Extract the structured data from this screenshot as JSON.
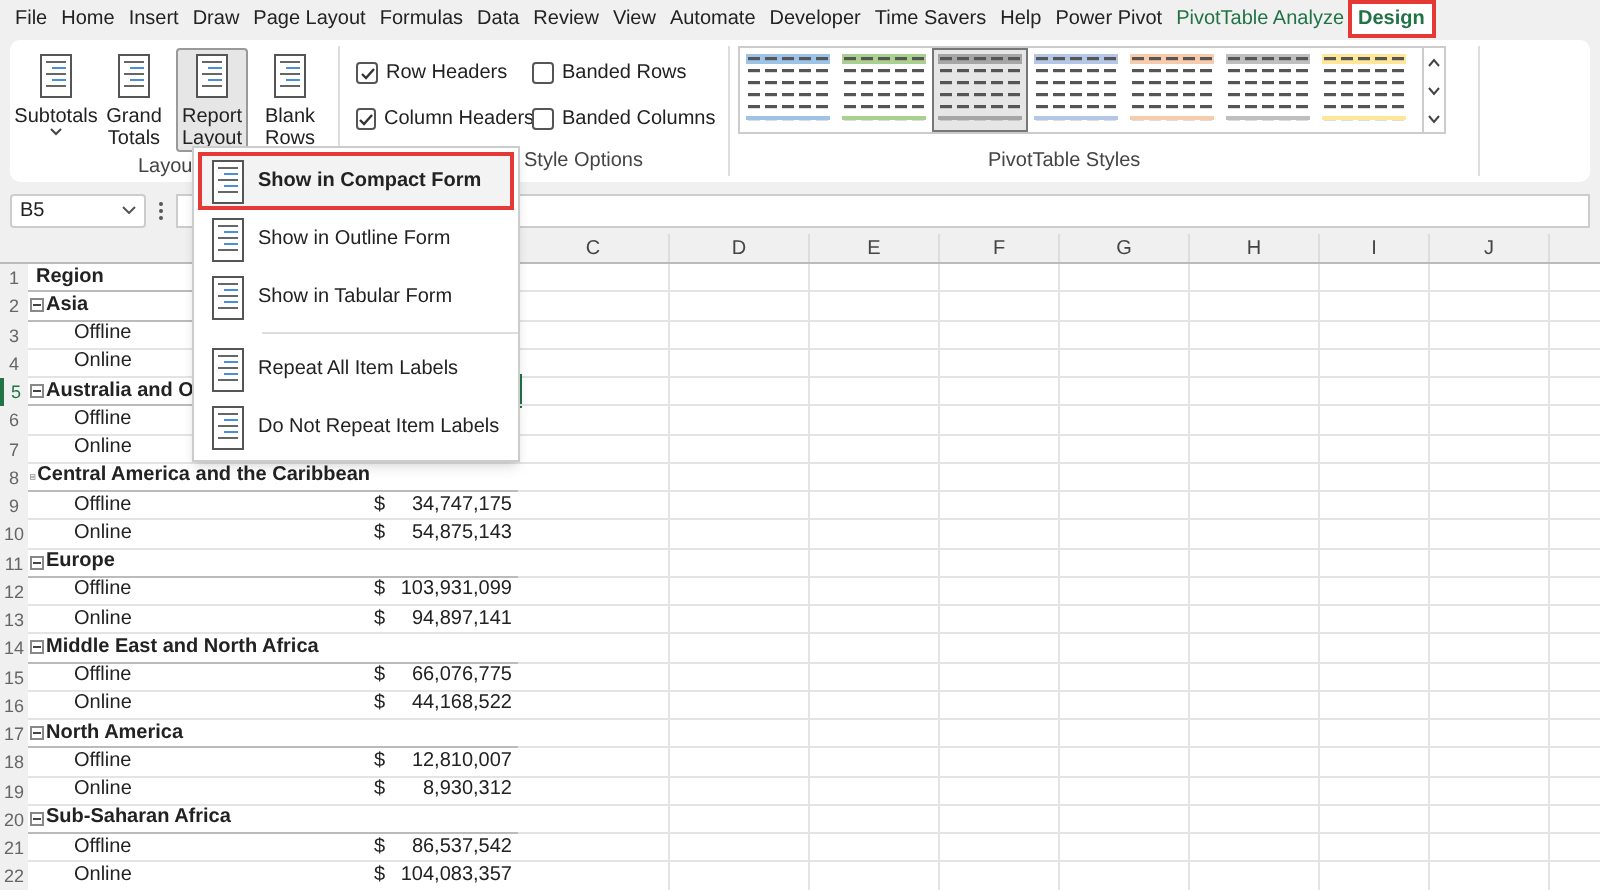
{
  "menu_tabs": [
    {
      "label": "File",
      "selected": false,
      "contextual": false,
      "annotated": false
    },
    {
      "label": "Home",
      "selected": false,
      "contextual": false,
      "annotated": false
    },
    {
      "label": "Insert",
      "selected": false,
      "contextual": false,
      "annotated": false
    },
    {
      "label": "Draw",
      "selected": false,
      "contextual": false,
      "annotated": false
    },
    {
      "label": "Page Layout",
      "selected": false,
      "contextual": false,
      "annotated": false
    },
    {
      "label": "Formulas",
      "selected": false,
      "contextual": false,
      "annotated": false
    },
    {
      "label": "Data",
      "selected": false,
      "contextual": false,
      "annotated": false
    },
    {
      "label": "Review",
      "selected": false,
      "contextual": false,
      "annotated": false
    },
    {
      "label": "View",
      "selected": false,
      "contextual": false,
      "annotated": false
    },
    {
      "label": "Automate",
      "selected": false,
      "contextual": false,
      "annotated": false
    },
    {
      "label": "Developer",
      "selected": false,
      "contextual": false,
      "annotated": false
    },
    {
      "label": "Time Savers",
      "selected": false,
      "contextual": false,
      "annotated": false
    },
    {
      "label": "Help",
      "selected": false,
      "contextual": false,
      "annotated": false
    },
    {
      "label": "Power Pivot",
      "selected": false,
      "contextual": false,
      "annotated": false
    },
    {
      "label": "PivotTable Analyze",
      "selected": false,
      "contextual": true,
      "annotated": false
    },
    {
      "label": "Design",
      "selected": true,
      "contextual": true,
      "annotated": true
    }
  ],
  "ribbon": {
    "layout_group": {
      "label": "Layou",
      "buttons": [
        {
          "lines": [
            "Subtotals"
          ],
          "selected": false
        },
        {
          "lines": [
            "Grand",
            "Totals"
          ],
          "selected": false
        },
        {
          "lines": [
            "Report",
            "Layout"
          ],
          "selected": true
        },
        {
          "lines": [
            "Blank",
            "Rows"
          ],
          "selected": false
        }
      ]
    },
    "style_options_group": {
      "label": "Style Options",
      "options": [
        {
          "label": "Row Headers",
          "checked": true
        },
        {
          "label": "Banded Rows",
          "checked": false
        },
        {
          "label": "Column Headers",
          "checked": true
        },
        {
          "label": "Banded Columns",
          "checked": false
        }
      ]
    },
    "styles_group": {
      "label": "PivotTable Styles",
      "styles": [
        {
          "color": "#9dc3e6",
          "selected": false
        },
        {
          "color": "#a9d08e",
          "selected": false
        },
        {
          "color": "#a6a6a6",
          "selected": true
        },
        {
          "color": "#b4c7e7",
          "selected": false
        },
        {
          "color": "#f8cbad",
          "selected": false
        },
        {
          "color": "#bfbfbf",
          "selected": false
        },
        {
          "color": "#ffe699",
          "selected": false
        }
      ]
    }
  },
  "name_box": {
    "value": "B5"
  },
  "columns": [
    "C",
    "D",
    "E",
    "F",
    "G",
    "H",
    "I",
    "J"
  ],
  "rows": [
    {
      "number": "1",
      "kind": "header",
      "label": "Region",
      "selected": false
    },
    {
      "number": "2",
      "kind": "region",
      "label": "Asia",
      "selected": false
    },
    {
      "number": "3",
      "kind": "item",
      "label": "Offline",
      "selected": false
    },
    {
      "number": "4",
      "kind": "item",
      "label": "Online",
      "selected": false
    },
    {
      "number": "5",
      "kind": "region",
      "label": "Australia and O",
      "selected": true
    },
    {
      "number": "6",
      "kind": "item",
      "label": "Offline",
      "selected": false
    },
    {
      "number": "7",
      "kind": "item",
      "label": "Online",
      "selected": false
    },
    {
      "number": "8",
      "kind": "region",
      "label": "Central America and the Caribbean",
      "selected": false
    },
    {
      "number": "9",
      "kind": "item",
      "label": "Offline",
      "currency": "$",
      "value": "34,747,175",
      "selected": false
    },
    {
      "number": "10",
      "kind": "item",
      "label": "Online",
      "currency": "$",
      "value": "54,875,143",
      "selected": false
    },
    {
      "number": "11",
      "kind": "region",
      "label": "Europe",
      "selected": false
    },
    {
      "number": "12",
      "kind": "item",
      "label": "Offline",
      "currency": "$",
      "value": "103,931,099",
      "selected": false
    },
    {
      "number": "13",
      "kind": "item",
      "label": "Online",
      "currency": "$",
      "value": "94,897,141",
      "selected": false
    },
    {
      "number": "14",
      "kind": "region",
      "label": "Middle East and North Africa",
      "selected": false
    },
    {
      "number": "15",
      "kind": "item",
      "label": "Offline",
      "currency": "$",
      "value": "66,076,775",
      "selected": false
    },
    {
      "number": "16",
      "kind": "item",
      "label": "Online",
      "currency": "$",
      "value": "44,168,522",
      "selected": false
    },
    {
      "number": "17",
      "kind": "region",
      "label": "North America",
      "selected": false
    },
    {
      "number": "18",
      "kind": "item",
      "label": "Offline",
      "currency": "$",
      "value": "12,810,007",
      "selected": false
    },
    {
      "number": "19",
      "kind": "item",
      "label": "Online",
      "currency": "$",
      "value": "8,930,312",
      "selected": false
    },
    {
      "number": "20",
      "kind": "region",
      "label": "Sub-Saharan Africa",
      "selected": false
    },
    {
      "number": "21",
      "kind": "item",
      "label": "Offline",
      "currency": "$",
      "value": "86,537,542",
      "selected": false
    },
    {
      "number": "22",
      "kind": "item",
      "label": "Online",
      "currency": "$",
      "value": "104,083,357",
      "selected": false
    }
  ],
  "dropdown_menu": {
    "items": [
      {
        "kind": "item",
        "label": "Show in Compact Form",
        "selected": true,
        "annotated": true
      },
      {
        "kind": "item",
        "label": "Show in Outline Form",
        "selected": false,
        "annotated": false
      },
      {
        "kind": "item",
        "label": "Show in Tabular Form",
        "selected": false,
        "annotated": false
      },
      {
        "kind": "separator"
      },
      {
        "kind": "item",
        "label": "Repeat All Item Labels",
        "selected": false,
        "annotated": false
      },
      {
        "kind": "item",
        "label": "Do Not Repeat Item Labels",
        "selected": false,
        "annotated": false
      }
    ]
  }
}
